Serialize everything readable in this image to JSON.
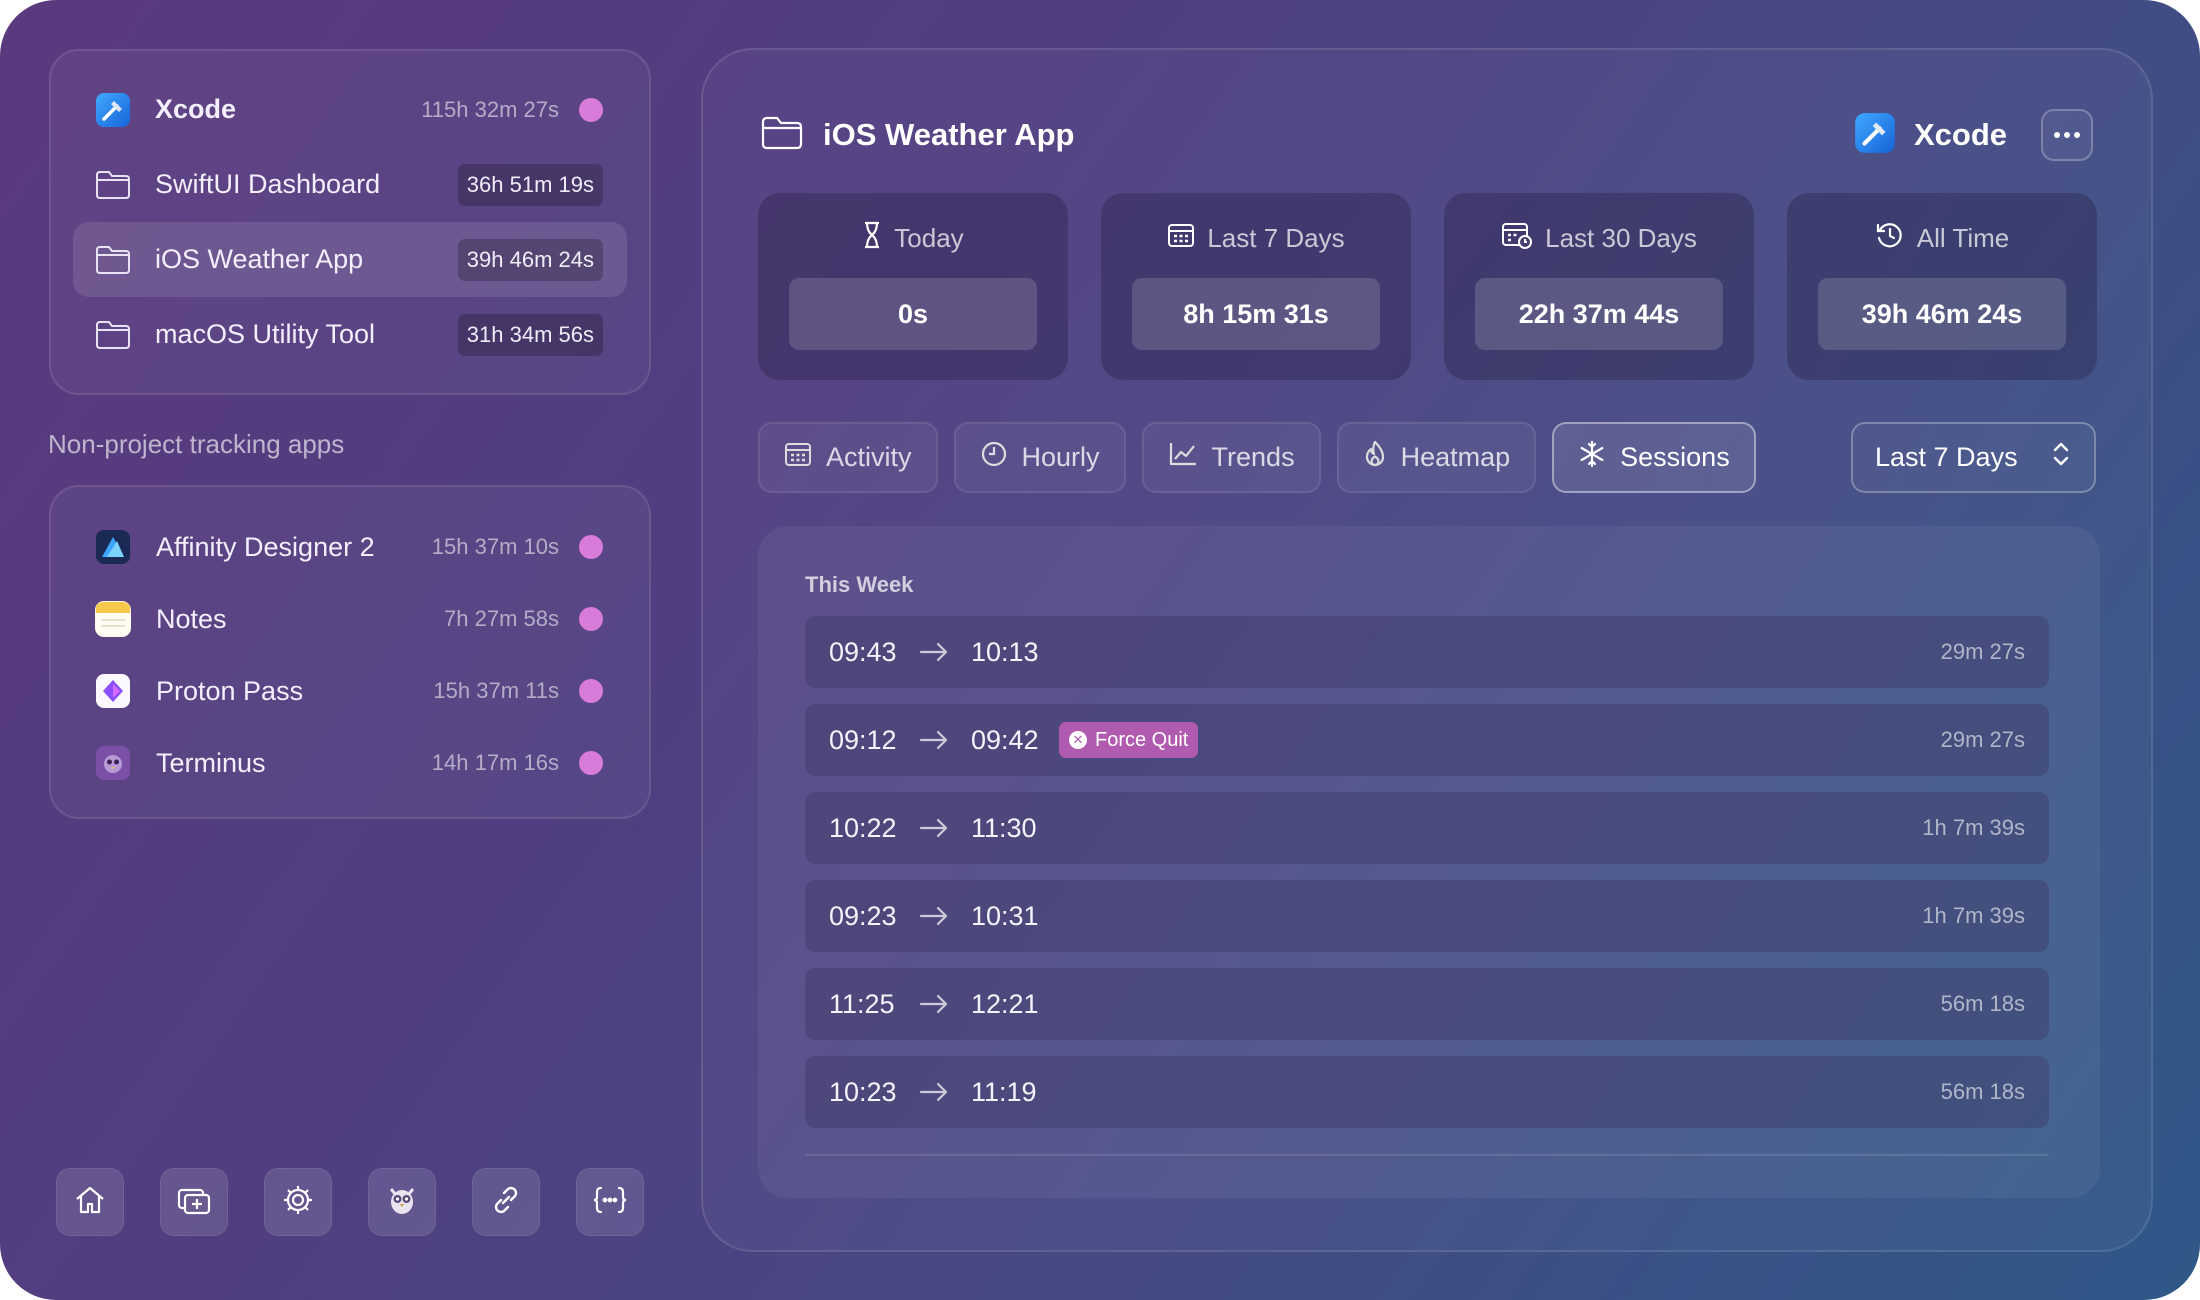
{
  "sidebar": {
    "projects": [
      {
        "name": "Xcode",
        "time": "115h 32m 27s",
        "icon": "xcode-icon",
        "style": "plain"
      },
      {
        "name": "SwiftUI Dashboard",
        "time": "36h 51m 19s",
        "icon": "folder-icon",
        "style": "pill"
      },
      {
        "name": "iOS Weather App",
        "time": "39h 46m 24s",
        "icon": "folder-icon",
        "style": "pill",
        "selected": true
      },
      {
        "name": "macOS Utility Tool",
        "time": "31h 34m 56s",
        "icon": "folder-icon",
        "style": "pill"
      }
    ],
    "section_label": "Non-project tracking apps",
    "apps": [
      {
        "name": "Affinity Designer 2",
        "time": "15h 37m 10s",
        "icon": "affinity-designer-icon"
      },
      {
        "name": "Notes",
        "time": "7h 27m 58s",
        "icon": "notes-icon"
      },
      {
        "name": "Proton Pass",
        "time": "15h 37m 11s",
        "icon": "proton-pass-icon"
      },
      {
        "name": "Terminus",
        "time": "14h 17m 16s",
        "icon": "terminus-icon"
      }
    ],
    "toolbar": [
      "home-icon",
      "add-window-icon",
      "gear-icon",
      "owl-icon",
      "link-icon",
      "braces-icon"
    ]
  },
  "header": {
    "title": "iOS Weather App",
    "app_name": "Xcode"
  },
  "stats": [
    {
      "label": "Today",
      "value": "0s",
      "icon": "hourglass-icon"
    },
    {
      "label": "Last 7 Days",
      "value": "8h 15m 31s",
      "icon": "calendar-icon"
    },
    {
      "label": "Last 30 Days",
      "value": "22h 37m 44s",
      "icon": "calendar-clock-icon"
    },
    {
      "label": "All Time",
      "value": "39h 46m 24s",
      "icon": "history-icon"
    }
  ],
  "tabs": [
    {
      "label": "Activity",
      "icon": "calendar-icon"
    },
    {
      "label": "Hourly",
      "icon": "clock-icon"
    },
    {
      "label": "Trends",
      "icon": "chart-line-icon"
    },
    {
      "label": "Heatmap",
      "icon": "flame-icon"
    },
    {
      "label": "Sessions",
      "icon": "snowflake-icon",
      "active": true
    }
  ],
  "range_select": {
    "value": "Last 7 Days"
  },
  "sessions": {
    "group_label": "This Week",
    "items": [
      {
        "start": "09:43",
        "end": "10:13",
        "duration": "29m 27s"
      },
      {
        "start": "09:12",
        "end": "09:42",
        "duration": "29m 27s",
        "badge": "Force Quit"
      },
      {
        "start": "10:22",
        "end": "11:30",
        "duration": "1h 7m 39s"
      },
      {
        "start": "09:23",
        "end": "10:31",
        "duration": "1h 7m 39s"
      },
      {
        "start": "11:25",
        "end": "12:21",
        "duration": "56m 18s"
      },
      {
        "start": "10:23",
        "end": "11:19",
        "duration": "56m 18s"
      }
    ]
  },
  "colors": {
    "accent_dot": "#d97bd8",
    "badge": "#b15bb0"
  }
}
